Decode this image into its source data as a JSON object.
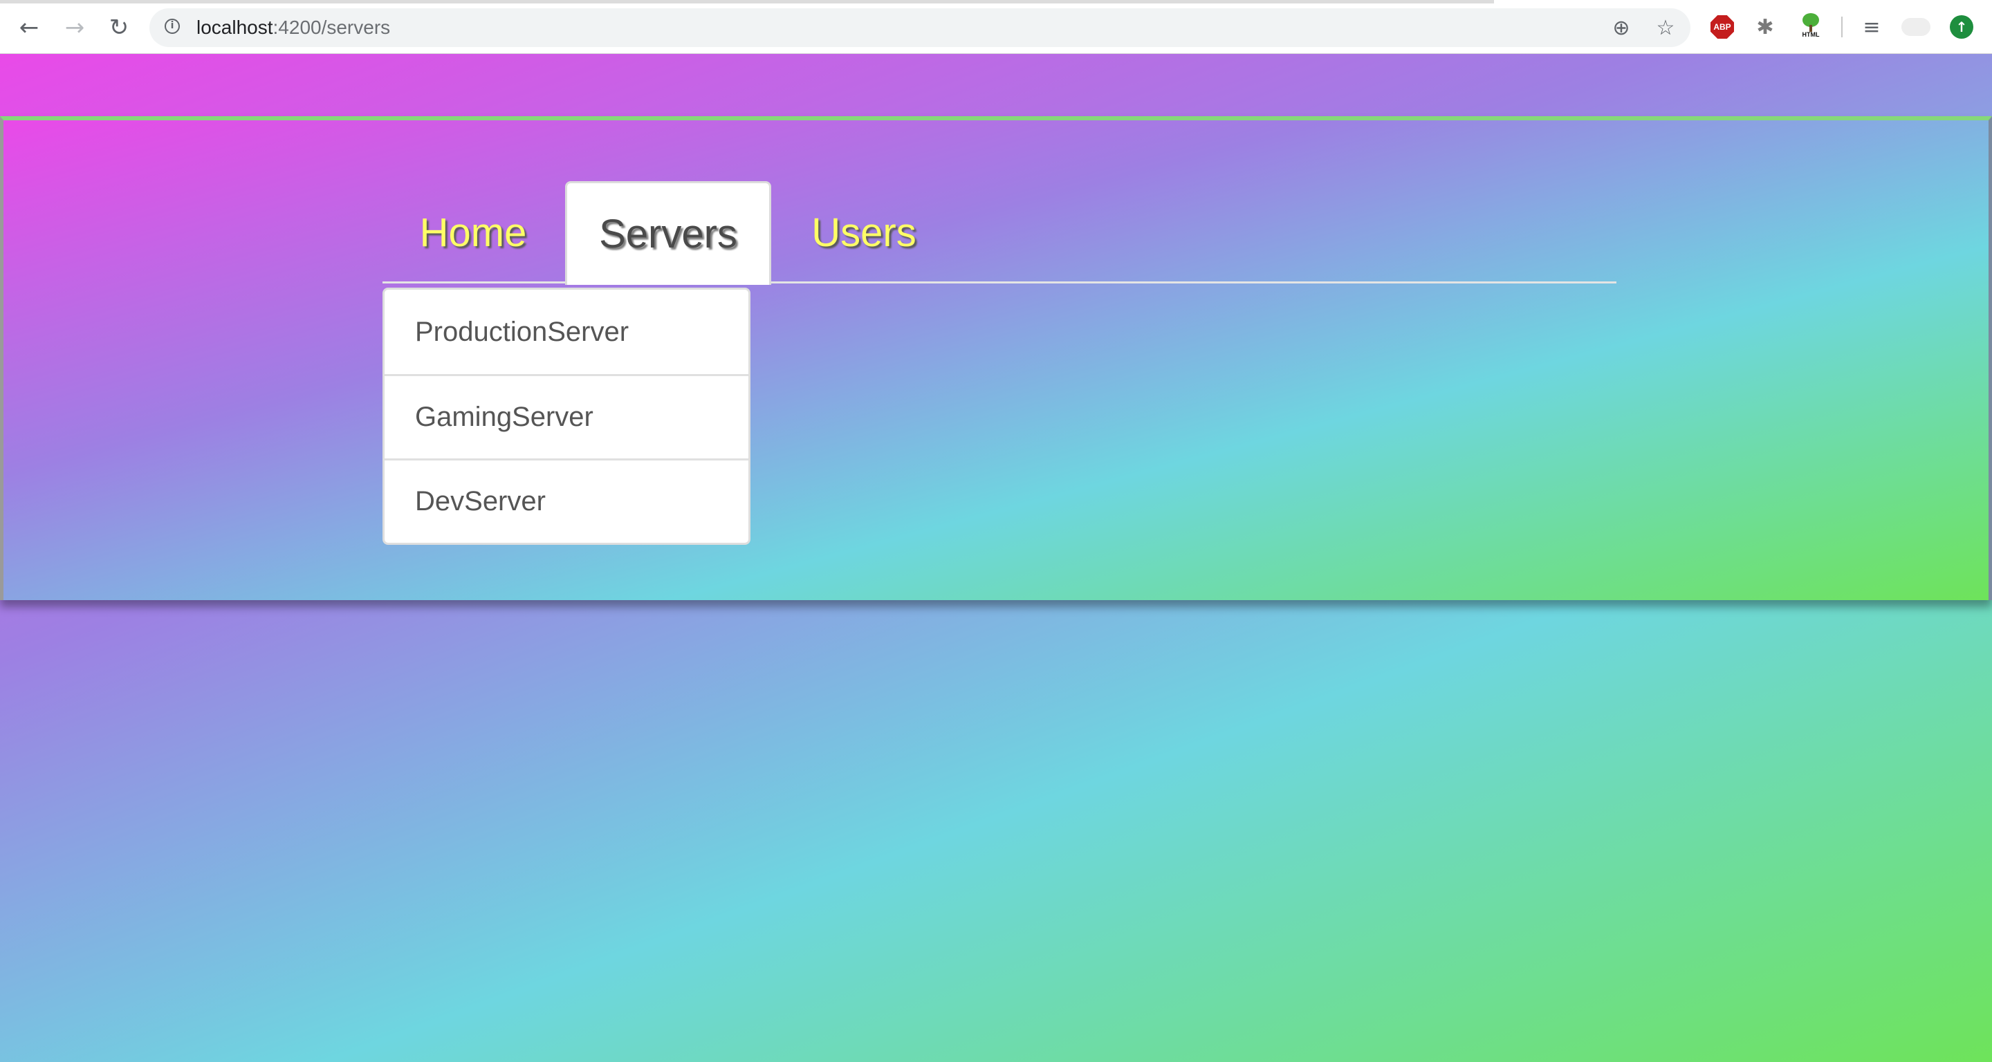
{
  "browser": {
    "back_icon": "←",
    "forward_icon": "→",
    "reload_icon": "↻",
    "url_host": "localhost",
    "url_path": ":4200/servers",
    "info_icon": "i",
    "zoom_icon": "⊕",
    "star_icon": "☆",
    "abp_label": "ABP",
    "bug_icon": "✱",
    "html_ext_label": "HTML",
    "playlist_icon": "≡",
    "update_icon": "↑"
  },
  "nav": {
    "tabs": [
      {
        "label": "Home",
        "active": false
      },
      {
        "label": "Servers",
        "active": true
      },
      {
        "label": "Users",
        "active": false
      }
    ]
  },
  "dropdown": {
    "items": [
      {
        "label": "ProductionServer"
      },
      {
        "label": "GamingServer"
      },
      {
        "label": "DevServer"
      }
    ]
  },
  "colors": {
    "tab_text": "#ffff66",
    "active_tab_text": "#4a4a4a",
    "gradient_stops": [
      "#e94ae8",
      "#9d80e3",
      "#6ed6e0",
      "#6ee35a"
    ]
  }
}
